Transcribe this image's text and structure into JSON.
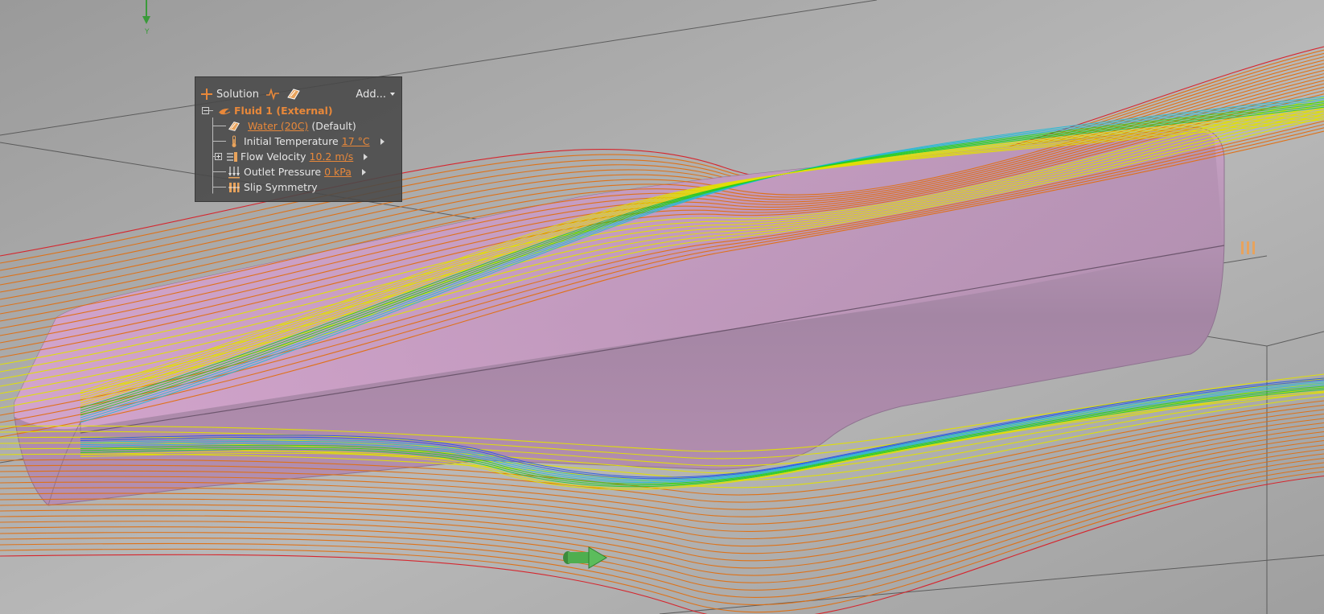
{
  "viewport": {
    "background": "#a9a9a9",
    "body_color": "#c79cc0",
    "axis_label": "Y"
  },
  "colors": {
    "accent": "#e8883a",
    "panel_text": "#e6e6e6",
    "axis_green": "#3a9a3a",
    "stream_red": "#d81f26",
    "stream_orange": "#e06f10",
    "stream_yellow": "#e2e000",
    "stream_green": "#1fcf1f",
    "stream_cyan": "#21b9d6",
    "stream_blue": "#2255e8"
  },
  "toolbar": {
    "solution_label": "Solution",
    "add_label": "Add...",
    "icons": [
      "plus-icon",
      "monitor-icon",
      "material-icon",
      "caret-down-icon"
    ]
  },
  "tree": {
    "fluid": {
      "label": "Fluid 1 (External)",
      "icon": "fluid-icon"
    },
    "material": {
      "value": "Water (20C)",
      "suffix": "(Default)",
      "icon": "material-icon"
    },
    "initial_temperature": {
      "label": "Initial Temperature",
      "value": "17 °C",
      "icon": "thermometer-icon"
    },
    "flow_velocity": {
      "label": "Flow Velocity",
      "value": "10.2 m/s",
      "icon": "flow-velocity-icon"
    },
    "outlet_pressure": {
      "label": "Outlet Pressure",
      "value": "0 kPa",
      "icon": "outlet-pressure-icon"
    },
    "slip_symmetry": {
      "label": "Slip Symmetry",
      "icon": "slip-symmetry-icon"
    }
  }
}
